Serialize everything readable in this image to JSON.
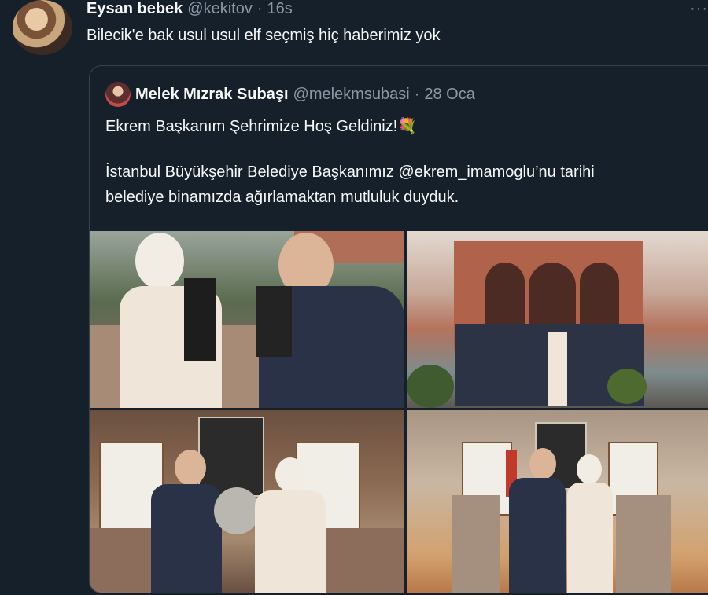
{
  "tweet": {
    "name": "Eysan bebek",
    "handle": "@kekitov",
    "separator": "·",
    "time": "16s",
    "more": "···",
    "text": "Bilecik'e bak usul usul elf seçmiş hiç haberimiz yok"
  },
  "quote": {
    "name": "Melek Mızrak Subaşı",
    "handle": "@melekmsubasi",
    "separator": "·",
    "time": "28 Oca",
    "line1": "Ekrem Başkanım Şehrimize Hoş Geldiniz!💐",
    "line2": "İstanbul Büyükşehir Belediye Başkanımız @ekrem_imamoglu’nu tarihi",
    "line3": "belediye binamızda ağırlamaktan mutluluk duyduk.",
    "photos": [
      {
        "icon": "photo-handshake"
      },
      {
        "icon": "photo-group-building"
      },
      {
        "icon": "photo-gift-portrait"
      },
      {
        "icon": "photo-office-portrait"
      }
    ]
  },
  "colors": {
    "background": "#15202b",
    "text": "#f7f9f9",
    "secondary": "#8b98a5",
    "border": "#38444d"
  }
}
